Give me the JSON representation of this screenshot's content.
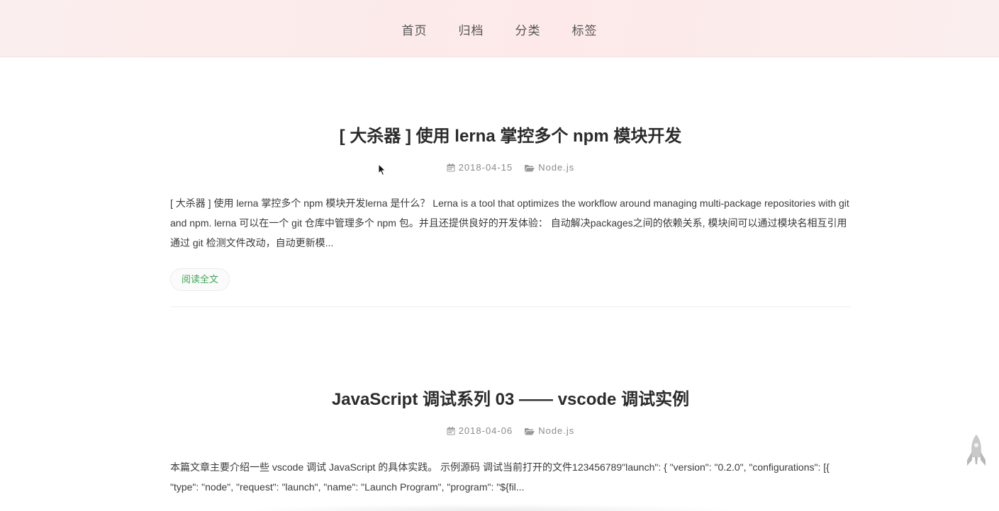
{
  "nav": {
    "items": [
      "首页",
      "归档",
      "分类",
      "标签"
    ]
  },
  "posts": [
    {
      "title": "[ 大杀器 ] 使用 lerna 掌控多个 npm 模块开发",
      "date": "2018-04-15",
      "category": "Node.js",
      "excerpt": "[ 大杀器 ] 使用 lerna 掌控多个 npm 模块开发lerna 是什么？ Lerna is a tool that optimizes the workflow around managing multi-package repositories with git and npm. lerna 可以在一个 git 仓库中管理多个 npm 包。并且还提供良好的开发体验： 自动解决packages之间的依赖关系, 模块间可以通过模块名相互引用 通过 git 检测文件改动，自动更新模...",
      "read_more": "阅读全文"
    },
    {
      "title": "JavaScript 调试系列 03 —— vscode 调试实例",
      "date": "2018-04-06",
      "category": "Node.js",
      "excerpt": "本篇文章主要介绍一些 vscode 调试 JavaScript 的具体实践。 示例源码 调试当前打开的文件123456789\"launch\": { \"version\": \"0.2.0\", \"configurations\": [{ \"type\": \"node\", \"request\": \"launch\", \"name\": \"Launch Program\", \"program\": \"${fil..."
    }
  ],
  "icons": {
    "date": "calendar-icon",
    "category": "folder-open-icon",
    "back_to_top": "rocket-icon",
    "pointer": "mouse-cursor-icon"
  },
  "colors": {
    "header_bg": "#fbeeee",
    "read_more_text": "#3fa556",
    "meta_text": "#8a8a8a"
  }
}
